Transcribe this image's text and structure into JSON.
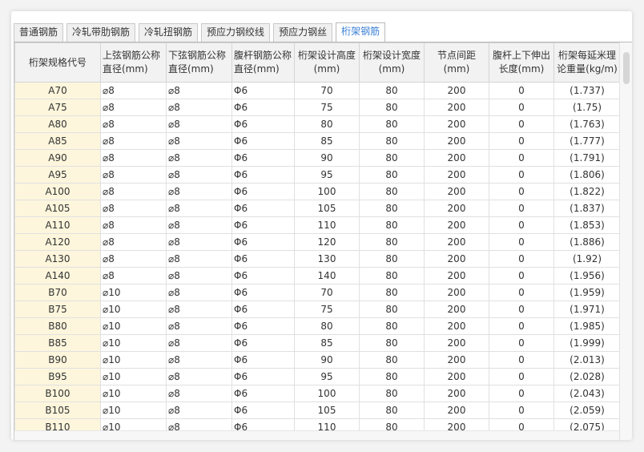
{
  "tabs": [
    {
      "label": "普通钢筋",
      "active": false
    },
    {
      "label": "冷轧带肋钢筋",
      "active": false
    },
    {
      "label": "冷轧扭钢筋",
      "active": false
    },
    {
      "label": "预应力钢绞线",
      "active": false
    },
    {
      "label": "预应力钢丝",
      "active": false
    },
    {
      "label": "桁架钢筋",
      "active": true
    }
  ],
  "table": {
    "headers": [
      "桁架规格代号",
      "上弦钢筋公称直径(mm)",
      "下弦钢筋公称直径(mm)",
      "腹杆钢筋公称直径(mm)",
      "桁架设计高度(mm)",
      "桁架设计宽度(mm)",
      "节点间距(mm)",
      "腹杆上下伸出长度(mm)",
      "桁架每延米理论重量(kg/m)"
    ],
    "rows": [
      [
        "A70",
        "⌀8",
        "⌀8",
        "Φ6",
        "70",
        "80",
        "200",
        "0",
        "(1.737)"
      ],
      [
        "A75",
        "⌀8",
        "⌀8",
        "Φ6",
        "75",
        "80",
        "200",
        "0",
        "(1.75)"
      ],
      [
        "A80",
        "⌀8",
        "⌀8",
        "Φ6",
        "80",
        "80",
        "200",
        "0",
        "(1.763)"
      ],
      [
        "A85",
        "⌀8",
        "⌀8",
        "Φ6",
        "85",
        "80",
        "200",
        "0",
        "(1.777)"
      ],
      [
        "A90",
        "⌀8",
        "⌀8",
        "Φ6",
        "90",
        "80",
        "200",
        "0",
        "(1.791)"
      ],
      [
        "A95",
        "⌀8",
        "⌀8",
        "Φ6",
        "95",
        "80",
        "200",
        "0",
        "(1.806)"
      ],
      [
        "A100",
        "⌀8",
        "⌀8",
        "Φ6",
        "100",
        "80",
        "200",
        "0",
        "(1.822)"
      ],
      [
        "A105",
        "⌀8",
        "⌀8",
        "Φ6",
        "105",
        "80",
        "200",
        "0",
        "(1.837)"
      ],
      [
        "A110",
        "⌀8",
        "⌀8",
        "Φ6",
        "110",
        "80",
        "200",
        "0",
        "(1.853)"
      ],
      [
        "A120",
        "⌀8",
        "⌀8",
        "Φ6",
        "120",
        "80",
        "200",
        "0",
        "(1.886)"
      ],
      [
        "A130",
        "⌀8",
        "⌀8",
        "Φ6",
        "130",
        "80",
        "200",
        "0",
        "(1.92)"
      ],
      [
        "A140",
        "⌀8",
        "⌀8",
        "Φ6",
        "140",
        "80",
        "200",
        "0",
        "(1.956)"
      ],
      [
        "B70",
        "⌀10",
        "⌀8",
        "Φ6",
        "70",
        "80",
        "200",
        "0",
        "(1.959)"
      ],
      [
        "B75",
        "⌀10",
        "⌀8",
        "Φ6",
        "75",
        "80",
        "200",
        "0",
        "(1.971)"
      ],
      [
        "B80",
        "⌀10",
        "⌀8",
        "Φ6",
        "80",
        "80",
        "200",
        "0",
        "(1.985)"
      ],
      [
        "B85",
        "⌀10",
        "⌀8",
        "Φ6",
        "85",
        "80",
        "200",
        "0",
        "(1.999)"
      ],
      [
        "B90",
        "⌀10",
        "⌀8",
        "Φ6",
        "90",
        "80",
        "200",
        "0",
        "(2.013)"
      ],
      [
        "B95",
        "⌀10",
        "⌀8",
        "Φ6",
        "95",
        "80",
        "200",
        "0",
        "(2.028)"
      ],
      [
        "B100",
        "⌀10",
        "⌀8",
        "Φ6",
        "100",
        "80",
        "200",
        "0",
        "(2.043)"
      ],
      [
        "B105",
        "⌀10",
        "⌀8",
        "Φ6",
        "105",
        "80",
        "200",
        "0",
        "(2.059)"
      ],
      [
        "B110",
        "⌀10",
        "⌀8",
        "Φ6",
        "110",
        "80",
        "200",
        "0",
        "(2.075)"
      ]
    ]
  },
  "colors": {
    "accent": "#3a7fd5",
    "code_cell_bg": "#fdf6dc",
    "header_bg": "#f2f2f2"
  }
}
